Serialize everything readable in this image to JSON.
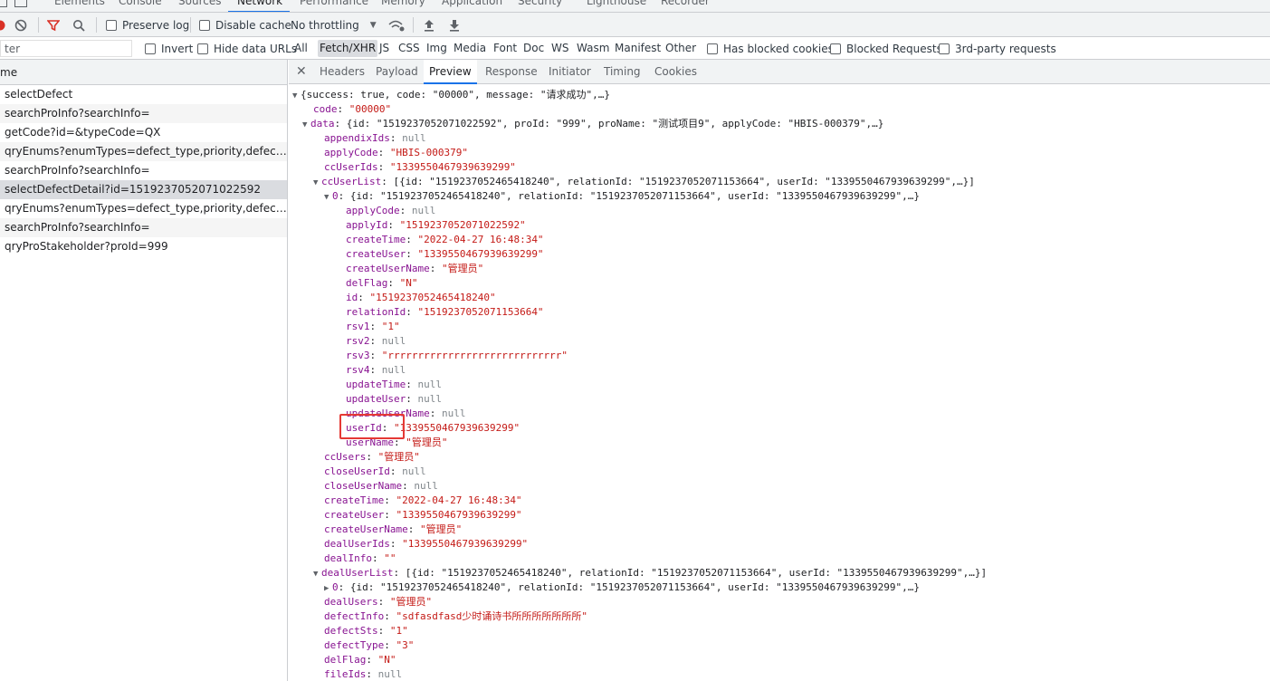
{
  "main_tabs": [
    "Elements",
    "Console",
    "Sources",
    "Network",
    "Performance",
    "Memory",
    "Application",
    "Security",
    "Lighthouse",
    "Recorder"
  ],
  "toolbar": {
    "preserve_log": "Preserve log",
    "disable_cache": "Disable cache",
    "throttling": "No throttling"
  },
  "filter": {
    "placeholder": "Filter",
    "value": "ter",
    "invert": "Invert",
    "hide_data_urls": "Hide data URLs",
    "types": [
      "All",
      "Fetch/XHR",
      "JS",
      "CSS",
      "Img",
      "Media",
      "Font",
      "Doc",
      "WS",
      "Wasm",
      "Manifest",
      "Other"
    ],
    "active_type": "Fetch/XHR",
    "has_blocked_cookies": "Has blocked cookies",
    "blocked_requests": "Blocked Requests",
    "third_party": "3rd-party requests"
  },
  "request_list": {
    "header": "me",
    "rows": [
      "selectDefect",
      "searchProInfo?searchInfo=",
      "getCode?id=&typeCode=QX",
      "qryEnums?enumTypes=defect_type,priority,defect_state,...",
      "searchProInfo?searchInfo=",
      "selectDefectDetail?id=1519237052071022592",
      "qryEnums?enumTypes=defect_type,priority,defect_state,...",
      "searchProInfo?searchInfo=",
      "qryProStakeholder?proId=999"
    ],
    "selected_index": 5
  },
  "detail_tabs": [
    "Headers",
    "Payload",
    "Preview",
    "Response",
    "Initiator",
    "Timing",
    "Cookies"
  ],
  "active_detail_tab": "Preview",
  "preview_lines": [
    {
      "tri": "▼",
      "k": "",
      "v": "{success: true, code: \"00000\", message: \"请求成功\",…}",
      "t": "p"
    },
    {
      "tri": "",
      "k": "code",
      "v": "\"00000\"",
      "t": "s"
    },
    {
      "tri": "▼",
      "k": "data",
      "v": "{id: \"1519237052071022592\", proId: \"999\", proName: \"测试项目9\", applyCode: \"HBIS-000379\",…}",
      "t": "p"
    },
    {
      "tri": "",
      "k": "appendixIds",
      "v": "null",
      "t": "n"
    },
    {
      "tri": "",
      "k": "applyCode",
      "v": "\"HBIS-000379\"",
      "t": "s"
    },
    {
      "tri": "",
      "k": "ccUserIds",
      "v": "\"1339550467939639299\"",
      "t": "s"
    },
    {
      "tri": "▼",
      "k": "ccUserList",
      "v": "[{id: \"1519237052465418240\", relationId: \"1519237052071153664\", userId: \"1339550467939639299\",…}]",
      "t": "p"
    },
    {
      "tri": "▼",
      "k": "0",
      "v": "{id: \"1519237052465418240\", relationId: \"1519237052071153664\", userId: \"1339550467939639299\",…}",
      "t": "p"
    },
    {
      "tri": "",
      "k": "applyCode",
      "v": "null",
      "t": "n"
    },
    {
      "tri": "",
      "k": "applyId",
      "v": "\"1519237052071022592\"",
      "t": "s"
    },
    {
      "tri": "",
      "k": "createTime",
      "v": "\"2022-04-27 16:48:34\"",
      "t": "s"
    },
    {
      "tri": "",
      "k": "createUser",
      "v": "\"1339550467939639299\"",
      "t": "s"
    },
    {
      "tri": "",
      "k": "createUserName",
      "v": "\"管理员\"",
      "t": "s"
    },
    {
      "tri": "",
      "k": "delFlag",
      "v": "\"N\"",
      "t": "s"
    },
    {
      "tri": "",
      "k": "id",
      "v": "\"1519237052465418240\"",
      "t": "s"
    },
    {
      "tri": "",
      "k": "relationId",
      "v": "\"1519237052071153664\"",
      "t": "s"
    },
    {
      "tri": "",
      "k": "rsv1",
      "v": "\"1\"",
      "t": "s"
    },
    {
      "tri": "",
      "k": "rsv2",
      "v": "null",
      "t": "n"
    },
    {
      "tri": "",
      "k": "rsv3",
      "v": "\"rrrrrrrrrrrrrrrrrrrrrrrrrrrrr\"",
      "t": "s"
    },
    {
      "tri": "",
      "k": "rsv4",
      "v": "null",
      "t": "n"
    },
    {
      "tri": "",
      "k": "updateTime",
      "v": "null",
      "t": "n"
    },
    {
      "tri": "",
      "k": "updateUser",
      "v": "null",
      "t": "n"
    },
    {
      "tri": "",
      "k": "updateUserName",
      "v": "null",
      "t": "n"
    },
    {
      "tri": "",
      "k": "userId",
      "v": "\"1339550467939639299\"",
      "t": "s"
    },
    {
      "tri": "",
      "k": "userName",
      "v": "\"管理员\"",
      "t": "s"
    },
    {
      "tri": "",
      "k": "ccUsers",
      "v": "\"管理员\"",
      "t": "s"
    },
    {
      "tri": "",
      "k": "closeUserId",
      "v": "null",
      "t": "n"
    },
    {
      "tri": "",
      "k": "closeUserName",
      "v": "null",
      "t": "n"
    },
    {
      "tri": "",
      "k": "createTime",
      "v": "\"2022-04-27 16:48:34\"",
      "t": "s"
    },
    {
      "tri": "",
      "k": "createUser",
      "v": "\"1339550467939639299\"",
      "t": "s"
    },
    {
      "tri": "",
      "k": "createUserName",
      "v": "\"管理员\"",
      "t": "s"
    },
    {
      "tri": "",
      "k": "dealUserIds",
      "v": "\"1339550467939639299\"",
      "t": "s"
    },
    {
      "tri": "",
      "k": "dealInfo",
      "v": "\"\"",
      "t": "s"
    },
    {
      "tri": "▼",
      "k": "dealUserList",
      "v": "[{id: \"1519237052465418240\", relationId: \"1519237052071153664\", userId: \"1339550467939639299\",…}]",
      "t": "p"
    },
    {
      "tri": "▶",
      "k": "0",
      "v": "{id: \"1519237052465418240\", relationId: \"1519237052071153664\", userId: \"1339550467939639299\",…}",
      "t": "p"
    },
    {
      "tri": "",
      "k": "dealUsers",
      "v": "\"管理员\"",
      "t": "s"
    },
    {
      "tri": "",
      "k": "defectInfo",
      "v": "\"sdfasdfasd少时诵诗书所所所所所所所\"",
      "t": "s"
    },
    {
      "tri": "",
      "k": "defectSts",
      "v": "\"1\"",
      "t": "s"
    },
    {
      "tri": "",
      "k": "defectType",
      "v": "\"3\"",
      "t": "s"
    },
    {
      "tri": "",
      "k": "delFlag",
      "v": "\"N\"",
      "t": "s"
    },
    {
      "tri": "",
      "k": "fileIds",
      "v": "null",
      "t": "n"
    }
  ],
  "colors": {
    "key": "#881391",
    "string": "#c41a16",
    "null": "#80868b",
    "highlight_box": "#e53935",
    "accent": "#1a73e8"
  }
}
